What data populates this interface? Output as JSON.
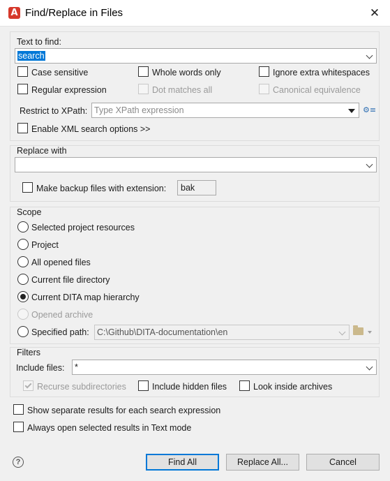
{
  "window": {
    "title": "Find/Replace in Files",
    "app_icon_letter": "A",
    "close_glyph": "✕"
  },
  "find": {
    "label": "Text to find:",
    "value": "search",
    "options": {
      "case_sensitive": {
        "label": "Case sensitive",
        "checked": false,
        "enabled": true
      },
      "whole_words": {
        "label": "Whole words only",
        "checked": false,
        "enabled": true
      },
      "ignore_ws": {
        "label": "Ignore extra whitespaces",
        "checked": false,
        "enabled": true
      },
      "regex": {
        "label": "Regular expression",
        "checked": false,
        "enabled": true
      },
      "dot_matches": {
        "label": "Dot matches all",
        "checked": false,
        "enabled": false
      },
      "canonical": {
        "label": "Canonical equivalence",
        "checked": false,
        "enabled": false
      }
    },
    "xpath_label": "Restrict to XPath:",
    "xpath_placeholder": "Type XPath expression",
    "xml_options_label": "Enable XML search options >>"
  },
  "replace": {
    "label": "Replace with",
    "value": "",
    "backup_label": "Make backup files with extension:",
    "backup_ext": "bak"
  },
  "scope": {
    "label": "Scope",
    "options": [
      {
        "label": "Selected project resources",
        "selected": false,
        "enabled": true
      },
      {
        "label": "Project",
        "selected": false,
        "enabled": true
      },
      {
        "label": "All opened files",
        "selected": false,
        "enabled": true
      },
      {
        "label": "Current file directory",
        "selected": false,
        "enabled": true
      },
      {
        "label": "Current DITA map hierarchy",
        "selected": true,
        "enabled": true
      },
      {
        "label": "Opened archive",
        "selected": false,
        "enabled": false
      },
      {
        "label": "Specified path:",
        "selected": false,
        "enabled": true
      }
    ],
    "specified_path": "C:\\Github\\DITA-documentation\\en"
  },
  "filters": {
    "label": "Filters",
    "include_label": "Include files:",
    "include_value": "*",
    "recurse_label": "Recurse subdirectories",
    "hidden_label": "Include hidden files",
    "archives_label": "Look inside archives"
  },
  "bottom": {
    "separate_results": "Show separate results for each search expression",
    "text_mode": "Always open selected results in Text mode"
  },
  "buttons": {
    "find_all": "Find All",
    "replace_all": "Replace All...",
    "cancel": "Cancel",
    "help": "?"
  },
  "icons": {
    "gear": "gear-icon",
    "folder": "folder-icon",
    "help": "help-icon"
  }
}
